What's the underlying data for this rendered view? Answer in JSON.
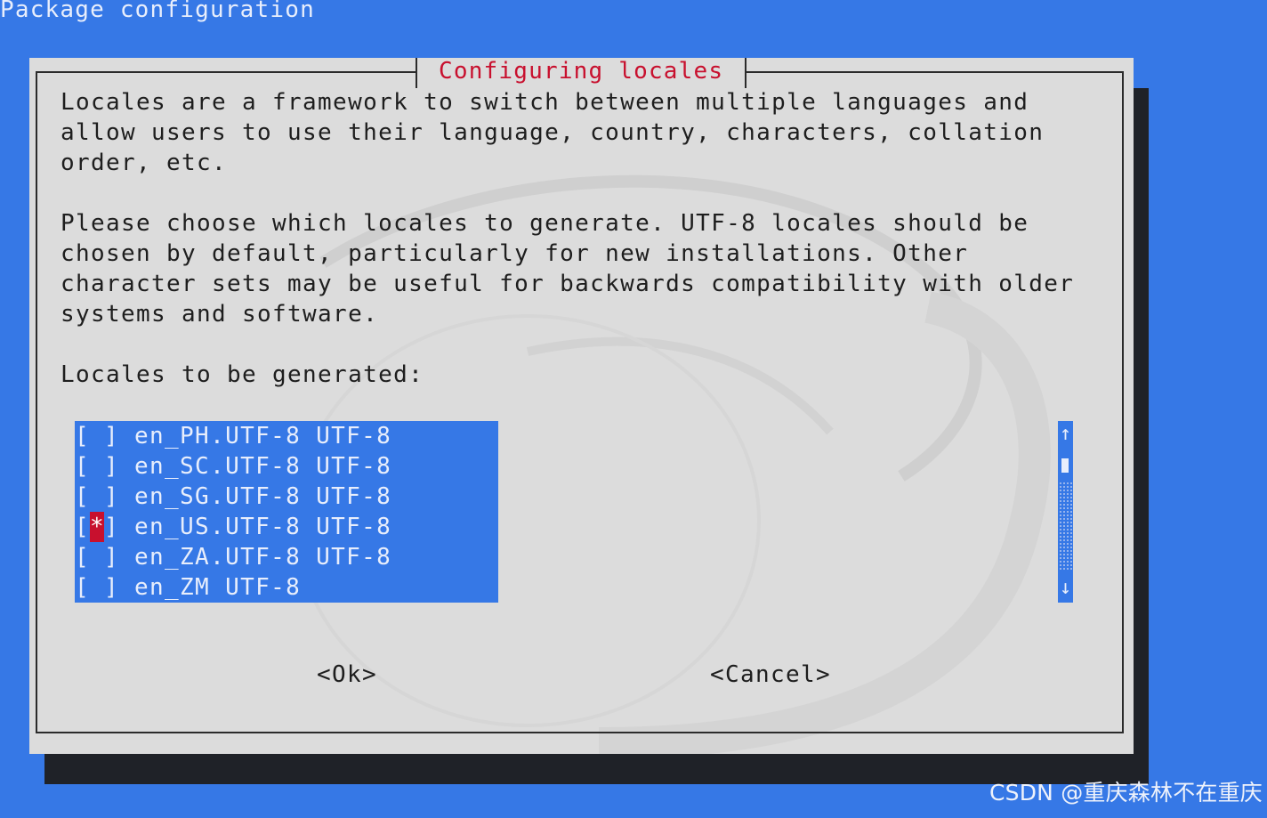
{
  "window": {
    "backtitle": "Package configuration"
  },
  "dialog": {
    "title": "Configuring locales",
    "paragraph1": "Locales are a framework to switch between multiple languages and\nallow users to use their language, country, characters, collation\norder, etc.",
    "paragraph2": "Please choose which locales to generate. UTF-8 locales should be\nchosen by default, particularly for new installations. Other\ncharacter sets may be useful for backwards compatibility with older\nsystems and software.",
    "list_label": "Locales to be generated:",
    "locales": [
      {
        "name": "en_PH.UTF-8 UTF-8",
        "checked": false
      },
      {
        "name": "en_SC.UTF-8 UTF-8",
        "checked": false
      },
      {
        "name": "en_SG.UTF-8 UTF-8",
        "checked": false
      },
      {
        "name": "en_US.UTF-8 UTF-8",
        "checked": true
      },
      {
        "name": "en_ZA.UTF-8 UTF-8",
        "checked": false
      },
      {
        "name": "en_ZM UTF-8",
        "checked": false
      }
    ],
    "checkbox_open": "[",
    "checkbox_close": "]",
    "checkbox_mark": "*",
    "scroll_up": "↑",
    "scroll_down": "↓",
    "ok_label": "<Ok>",
    "cancel_label": "<Cancel>"
  },
  "credit": "CSDN @重庆森林不在重庆",
  "colors": {
    "desktop": "#3678e6",
    "dialog_bg": "#dcdcdc",
    "title": "#c8102e",
    "list_bg": "#3678e6",
    "checked_mark_bg": "#c8102e"
  }
}
